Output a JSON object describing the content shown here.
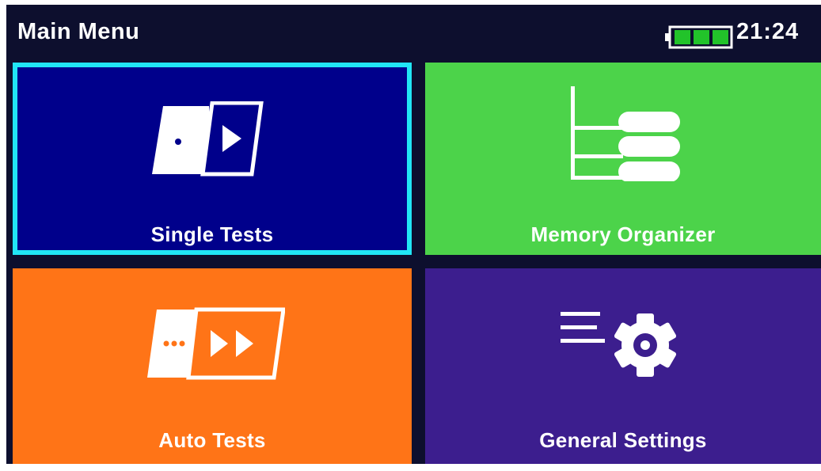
{
  "header": {
    "title": "Main Menu",
    "time": "21:24",
    "battery_icon": "battery-full-icon",
    "battery_level": 1.0
  },
  "tiles": [
    {
      "label": "Single Tests",
      "icon": "single-tests-icon",
      "color": "#00008b",
      "selected": true,
      "selection_color": "#21e5f5"
    },
    {
      "label": "Memory Organizer",
      "icon": "memory-tree-icon",
      "color": "#4cd34a",
      "selected": false
    },
    {
      "label": "Auto Tests",
      "icon": "auto-tests-icon",
      "color": "#ff7417",
      "selected": false
    },
    {
      "label": "General Settings",
      "icon": "settings-gear-icon",
      "color": "#3c1e8e",
      "selected": false
    }
  ],
  "colors": {
    "background": "#0d0f2e",
    "text": "#ffffff",
    "battery": "#22c32a"
  }
}
